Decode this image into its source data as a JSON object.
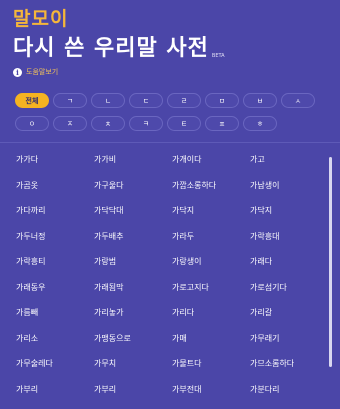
{
  "header": {
    "brand": "말모이",
    "title": "다시 쓴 우리말 사전",
    "title_tag": "BETA",
    "help_label": "도움말보기"
  },
  "filters": {
    "row1": [
      "전체",
      "ㄱ",
      "ㄴ",
      "ㄷ",
      "ㄹ",
      "ㅁ",
      "ㅂ",
      "ㅅ"
    ],
    "row2": [
      "ㅇ",
      "ㅈ",
      "ㅊ",
      "ㅋ",
      "ㅌ",
      "ㅍ",
      "ㅎ"
    ],
    "active": "전체"
  },
  "words": [
    "가가다",
    "가가비",
    "가개이다",
    "가고",
    "가곰옷",
    "가구울다",
    "가깝소롱하다",
    "가납생이",
    "가다까리",
    "가닥닥대",
    "가닥지",
    "가닥지",
    "가두너정",
    "가두배추",
    "가라두",
    "가락흥대",
    "가락흥티",
    "가랑범",
    "가랑생이",
    "가래다",
    "가래동우",
    "가래됨막",
    "가로고지다",
    "가로섬기다",
    "가름빼",
    "가리놓가",
    "가리다",
    "가리갈",
    "가리소",
    "가맹동으로",
    "가매",
    "가무래기",
    "가무술레다",
    "가무치",
    "가물트다",
    "가므소롬하다",
    "가부리",
    "가부리",
    "가부전대",
    "가분다리"
  ]
}
